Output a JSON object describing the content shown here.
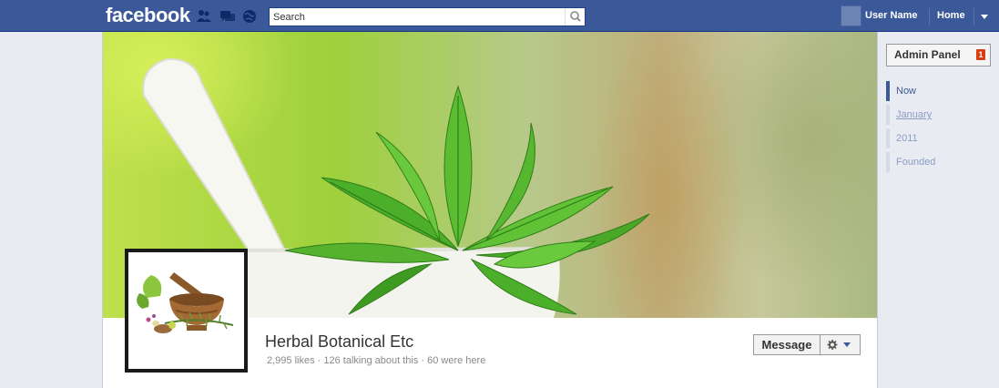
{
  "topbar": {
    "logo": "facebook",
    "search_placeholder": "Search",
    "user_name": "User Name",
    "home_label": "Home"
  },
  "cover": {
    "image": "mint leaves in white mortar and pestle"
  },
  "page": {
    "name": "Herbal Botanical Etc",
    "stats": "2,995 likes · 126 talking about this · 60 were here",
    "message_label": "Message"
  },
  "admin": {
    "label": "Admin Panel",
    "badge": "1"
  },
  "timeline": {
    "items": [
      {
        "label": "Now"
      },
      {
        "label": "January"
      },
      {
        "label": "2011"
      },
      {
        "label": "Founded"
      }
    ]
  },
  "colors": {
    "brand": "#3b5998",
    "badge": "#dd3c10"
  }
}
